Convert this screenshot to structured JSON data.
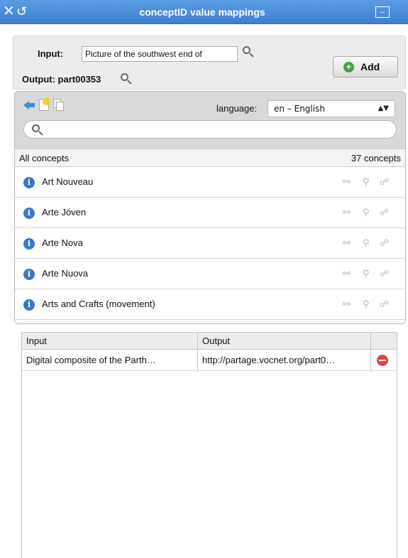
{
  "window": {
    "title": "conceptID value mappings",
    "close_icon": "close-icon",
    "refresh_icon": "refresh-icon",
    "resize_icon": "resize-icon",
    "title_bar_color": "#4a8cdb"
  },
  "form": {
    "input_label": "Input:",
    "input_value": "Picture of the southwest end of",
    "output_label": "Output:",
    "output_value": "part00353",
    "add_label": "Add"
  },
  "browser": {
    "language_label": "language:",
    "language_value": "en – English",
    "search_placeholder": "",
    "all_concepts_label": "All concepts",
    "concept_count": "37 concepts",
    "concepts": [
      {
        "label": "Art Nouveau"
      },
      {
        "label": "Arte Jóven"
      },
      {
        "label": "Arte Nova"
      },
      {
        "label": "Arte Nuova"
      },
      {
        "label": "Arts and Crafts (movement)"
      }
    ]
  },
  "mappings": {
    "columns": [
      "Input",
      "Output"
    ],
    "rows": [
      {
        "input": "Digital composite of the Parth…",
        "output": "http://partage.vocnet.org/part0…"
      }
    ]
  }
}
